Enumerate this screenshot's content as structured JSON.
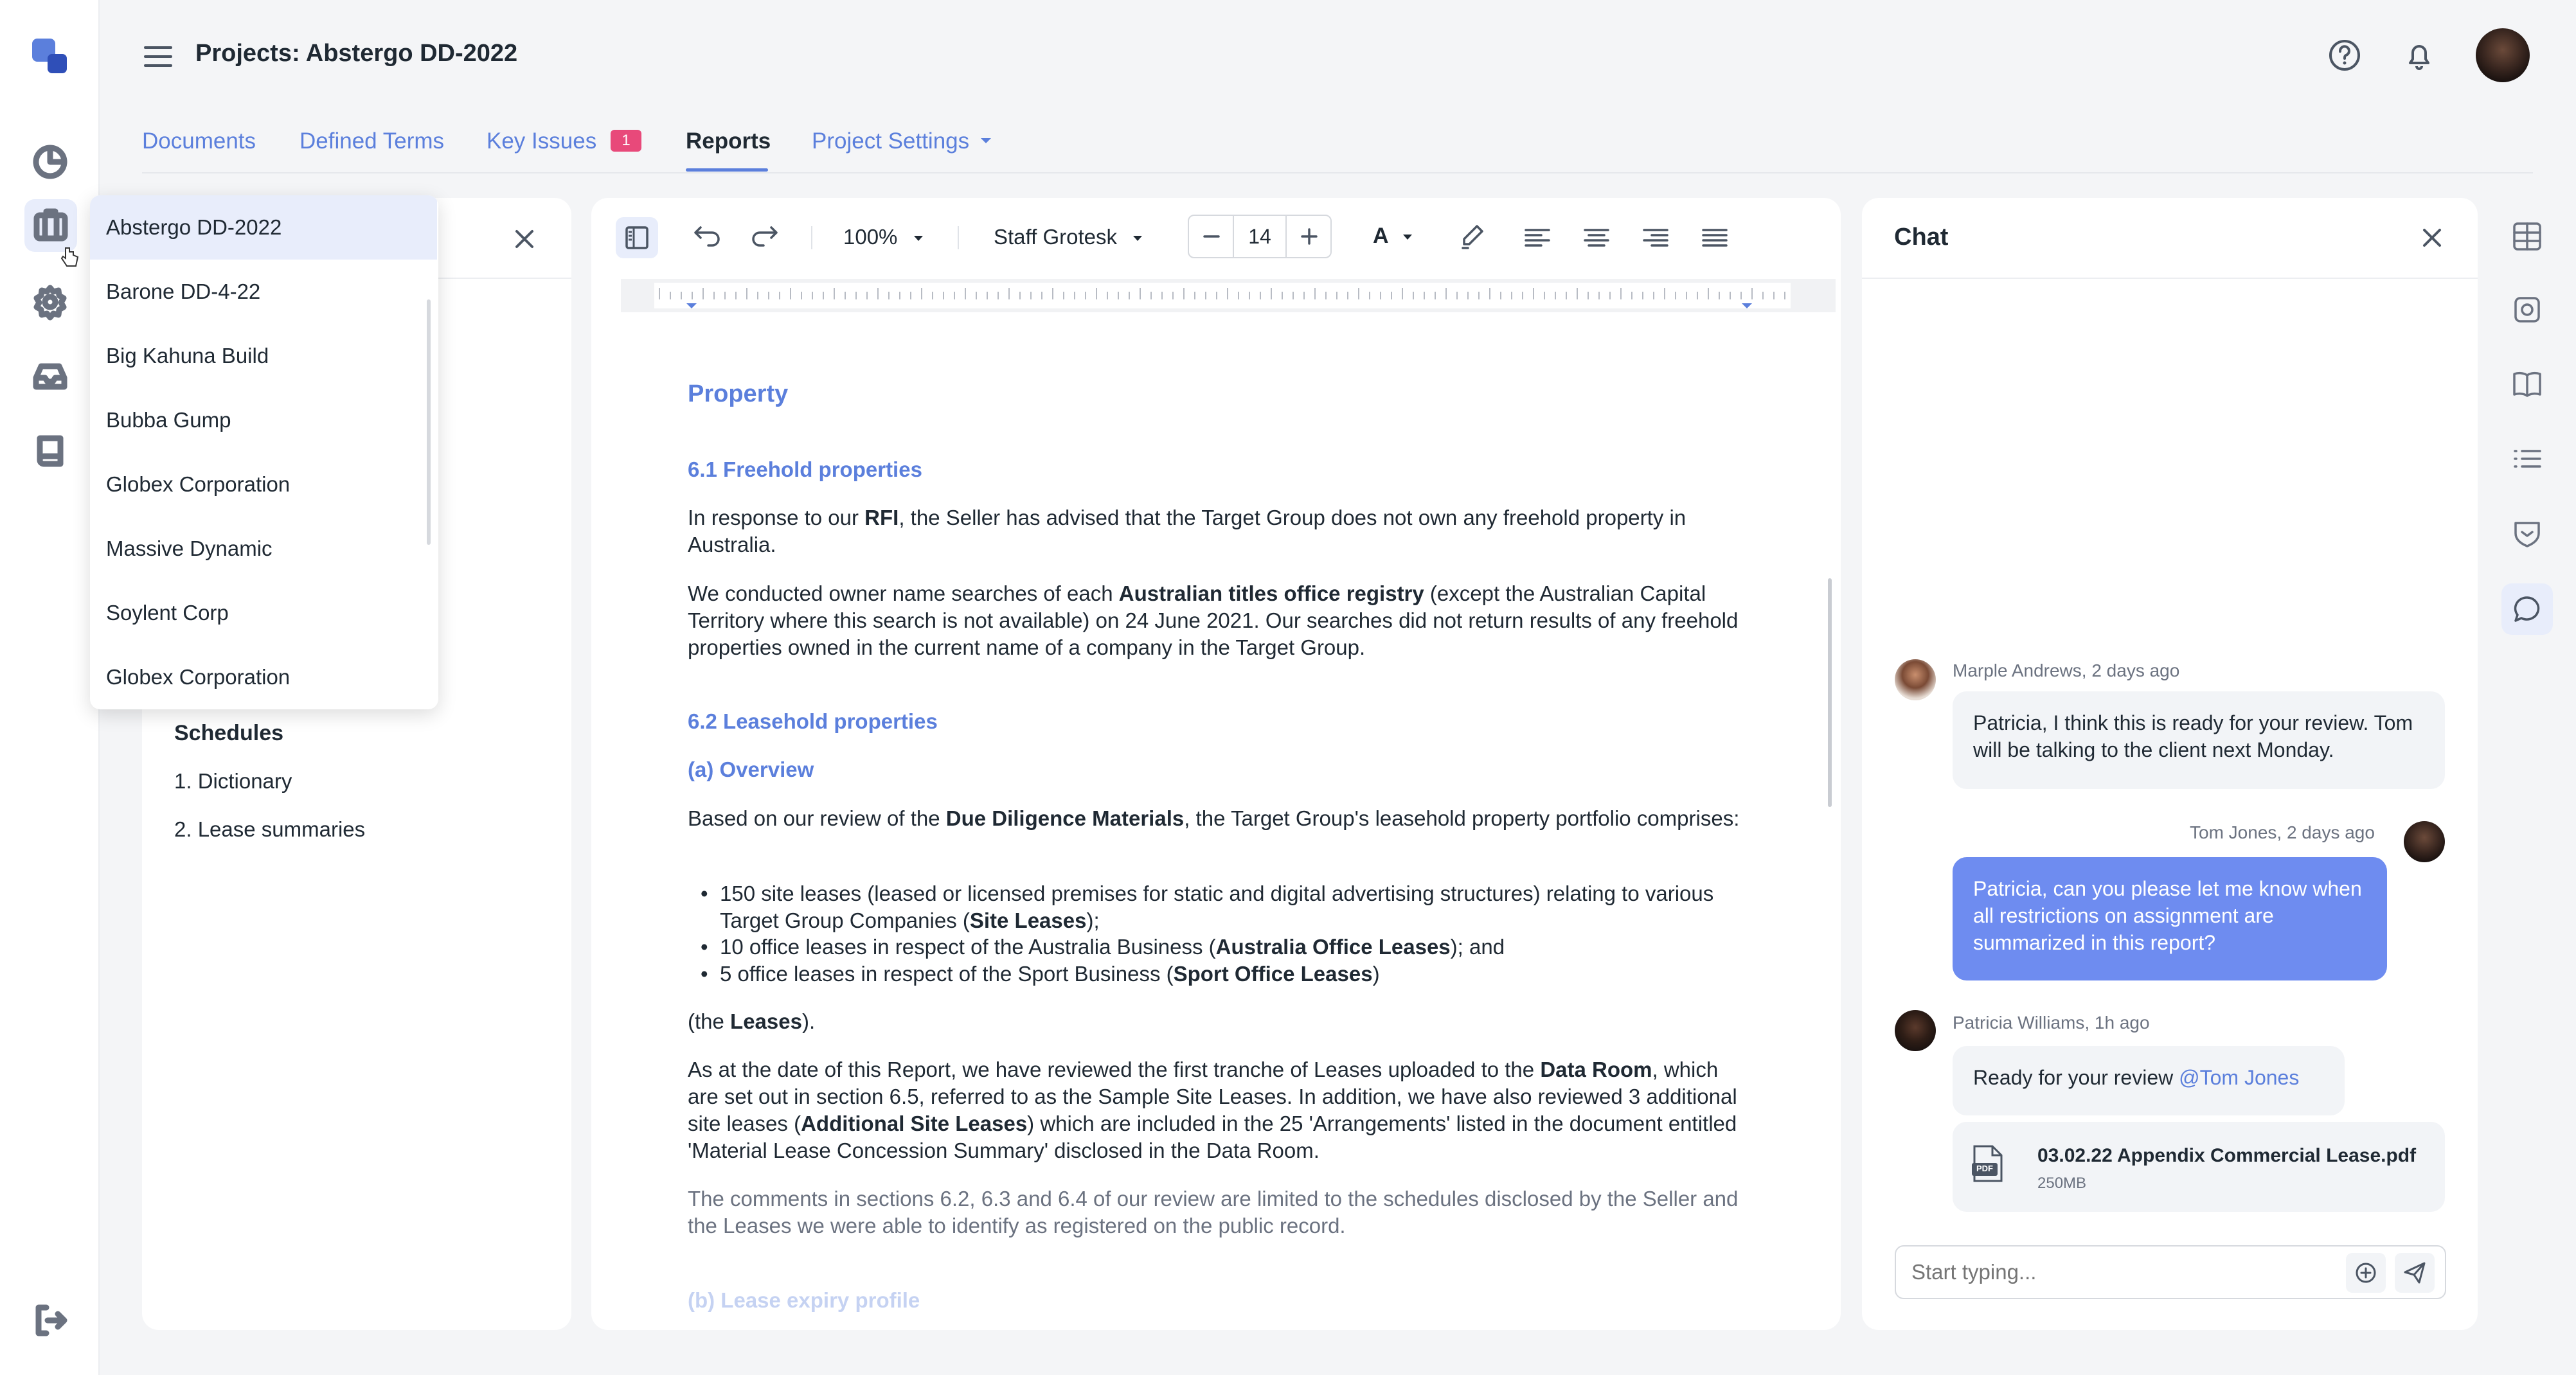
{
  "app": {
    "title": "Projects: Abstergo DD-2022"
  },
  "tabs": [
    {
      "label": "Documents"
    },
    {
      "label": "Defined Terms"
    },
    {
      "label": "Key Issues",
      "badge": "1"
    },
    {
      "label": "Reports",
      "active": true
    },
    {
      "label": "Project Settings"
    }
  ],
  "project_menu": {
    "items": [
      "Abstergo DD-2022",
      "Barone DD-4-22",
      "Big Kahuna Build",
      "Bubba Gump",
      "Globex Corporation",
      "Massive Dynamic",
      "Soylent Corp",
      "Globex Corporation"
    ],
    "selected_index": 0
  },
  "outline": {
    "section_title": "Schedules",
    "items": [
      "1. Dictionary",
      "2. Lease summaries"
    ]
  },
  "toolbar": {
    "zoom": "100%",
    "font": "Staff Grotesk",
    "font_size": "14",
    "text_color_label": "A"
  },
  "document": {
    "heading": "Property",
    "s61_title": "6.1 Freehold properties",
    "p1": {
      "a": "In response to our ",
      "b": "RFI",
      "c": ", the Seller has advised that the Target Group does not own any freehold property in Australia."
    },
    "p2": {
      "a": "We conducted owner name searches of each ",
      "b": "Australian titles office registry",
      "c": " (except the Australian Capital Territory where this search is not available) on 24 June 2021. Our searches did not return results of any freehold properties owned in the current name of a company in the Target Group."
    },
    "s62_title": "6.2 Leasehold properties",
    "sub_a": "(a) Overview",
    "p3": {
      "a": "Based on our review of the ",
      "b": "Due Diligence Materials",
      "c": ", the Target Group's leasehold property portfolio comprises:"
    },
    "bullets": [
      {
        "a": "150 site leases (leased or licensed premises for static and digital advertising structures) relating to various Target Group Companies (",
        "b": "Site Leases",
        "c": ");"
      },
      {
        "a": "10 office leases in respect of the Australia Business (",
        "b": "Australia Office Leases",
        "c": "); and"
      },
      {
        "a": "5 office leases in respect of the Sport Business (",
        "b": "Sport Office Leases",
        "c": ")"
      }
    ],
    "p4": {
      "a": "(the ",
      "b": "Leases",
      "c": ")."
    },
    "p5": {
      "a": "As at the date of this Report, we have reviewed the first tranche of Leases uploaded to the ",
      "b": "Data Room",
      "c": ", which are set out in section 6.5, referred to as the Sample Site Leases. In addition, we have also reviewed 3 additional site leases (",
      "d": "Additional Site Leases",
      "e": ") which are included in the 25 'Arrangements' listed in the document entitled 'Material Lease Concession Summary' disclosed in the Data Room."
    },
    "p6": "The comments in sections 6.2, 6.3 and 6.4 of our review are limited to the schedules disclosed by the Seller and the Leases we were able to identify as registered on the public record.",
    "sub_b": "(b) Lease expiry profile"
  },
  "chat": {
    "title": "Chat",
    "messages": [
      {
        "meta": "Marple Andrews, 2 days ago",
        "text": "Patricia, I think this is ready for your review. Tom will be talking to the client next Monday."
      },
      {
        "meta": "Tom Jones, 2 days ago",
        "text": "Patricia, can you please let me know when all restrictions on assignment are summarized in this report?"
      },
      {
        "meta": "Patricia Williams, 1h ago",
        "text": "Ready for your review ",
        "mention": "@Tom Jones"
      }
    ],
    "attachment": {
      "name": "03.02.22 Appendix Commercial Lease.pdf",
      "size": "250MB",
      "type": "PDF"
    },
    "input_placeholder": "Start typing..."
  },
  "colors": {
    "accent": "#5b7fdc",
    "badge": "#e8497a",
    "bubble_out": "#6e8cf0",
    "bubble_in": "#f2f4f7"
  }
}
